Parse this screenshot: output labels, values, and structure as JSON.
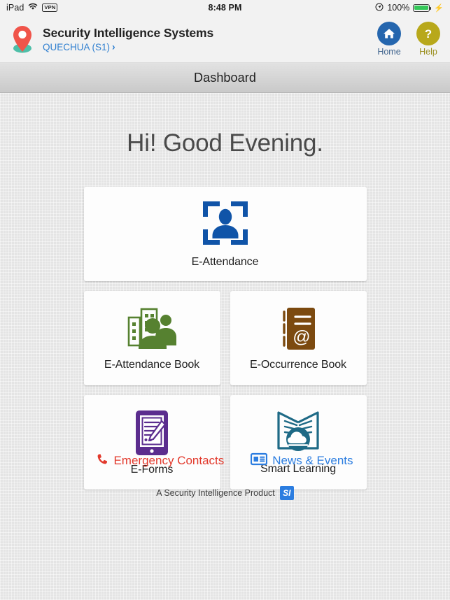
{
  "statusbar": {
    "device": "iPad",
    "wifi_icon": "wifi-icon",
    "vpn_label": "VPN",
    "time": "8:48 PM",
    "location_icon": "location-services-icon",
    "battery_percent": "100%",
    "battery_level": 100,
    "charging_icon": "charging-bolt-icon"
  },
  "header": {
    "logo_icon": "map-pin-logo",
    "title": "Security Intelligence Systems",
    "site": "QUECHUA (S1)",
    "site_chevron": "chevron-right-icon",
    "actions": [
      {
        "icon": "home-icon",
        "label": "Home",
        "color": "#2566ae"
      },
      {
        "icon": "help-question-icon",
        "label": "Help",
        "color": "#b8a81b"
      }
    ]
  },
  "page": {
    "title": "Dashboard",
    "greeting": "Hi! Good Evening."
  },
  "tiles": [
    {
      "name": "e-attendance",
      "label": "E-Attendance",
      "icon": "face-scan-icon",
      "color": "#1054a8"
    },
    {
      "name": "e-attendance-book",
      "label": "E-Attendance Book",
      "icon": "buildings-people-icon",
      "color": "#568130"
    },
    {
      "name": "e-occurrence-book",
      "label": "E-Occurrence Book",
      "icon": "ledger-at-icon",
      "color": "#7c4a10"
    },
    {
      "name": "e-forms",
      "label": "E-Forms",
      "icon": "tablet-form-pencil-icon",
      "color": "#5b2d8e"
    },
    {
      "name": "smart-learning",
      "label": "Smart Learning",
      "icon": "book-cloud-icon",
      "color": "#1e6a86"
    }
  ],
  "footer": {
    "emergency": {
      "icon": "phone-icon",
      "label": "Emergency Contacts",
      "color": "#e2392c"
    },
    "news": {
      "icon": "newspaper-icon",
      "label": "News & Events",
      "color": "#2b7de0"
    },
    "product_note": "A Security Intelligence Product",
    "product_logo_text": "SI"
  }
}
